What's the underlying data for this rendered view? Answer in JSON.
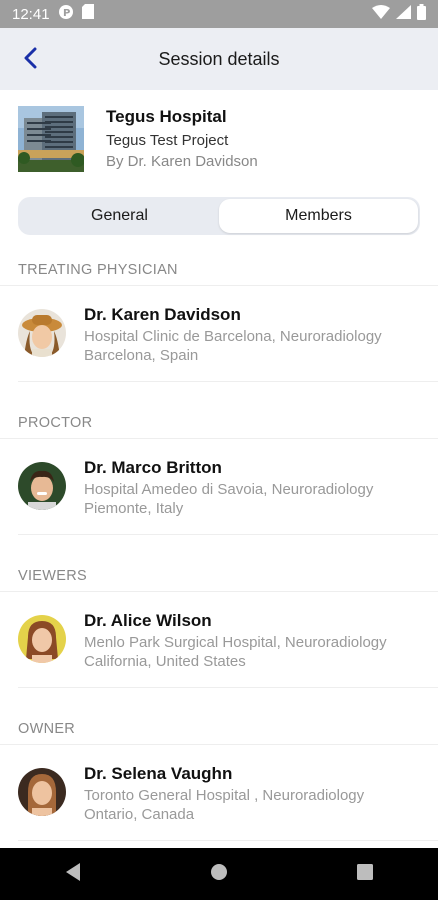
{
  "status_bar": {
    "time": "12:41",
    "icons": [
      "p-circle-icon",
      "sd-card-icon",
      "wifi-icon",
      "signal-icon",
      "battery-icon"
    ]
  },
  "app_bar": {
    "title": "Session details",
    "back_icon": "back-chevron-icon",
    "accent_color": "#1a2fa8"
  },
  "header": {
    "title": "Tegus Hospital",
    "subtitle": "Tegus Test Project",
    "by_line": "By Dr. Karen Davidson"
  },
  "tabs": [
    {
      "label": "General",
      "active": false
    },
    {
      "label": "Members",
      "active": true
    }
  ],
  "sections": [
    {
      "label": "TREATING PHYSICIAN",
      "member": {
        "name": "Dr. Karen Davidson",
        "line1": "Hospital Clinic de Barcelona, Neuroradiology",
        "line2": "Barcelona, Spain"
      }
    },
    {
      "label": "PROCTOR",
      "member": {
        "name": "Dr. Marco Britton",
        "line1": "Hospital Amedeo di Savoia, Neuroradiology",
        "line2": "Piemonte, Italy"
      }
    },
    {
      "label": "VIEWERS",
      "member": {
        "name": "Dr. Alice Wilson",
        "line1": "Menlo Park Surgical Hospital, Neuroradiology",
        "line2": "California, United States"
      }
    },
    {
      "label": "OWNER",
      "member": {
        "name": "Dr. Selena Vaughn",
        "line1": "Toronto General Hospital , Neuroradiology",
        "line2": "Ontario, Canada"
      }
    }
  ],
  "nav_bar": {
    "icons": [
      "back-triangle-icon",
      "home-circle-icon",
      "recents-square-icon"
    ]
  }
}
